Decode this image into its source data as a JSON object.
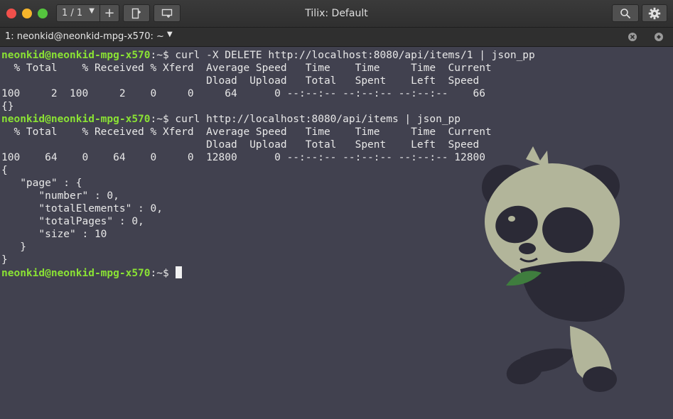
{
  "window": {
    "title": "Tilix: Default"
  },
  "header": {
    "session_counter": "1 / 1",
    "add_label": "+"
  },
  "tab": {
    "label": "1: neonkid@neonkid-mpg-x570: ~"
  },
  "colors": {
    "background": "#41414f",
    "prompt": "#8ae234",
    "text": "#e8e8e8"
  },
  "terminal": {
    "lines": [
      {
        "prompt": "neonkid@neonkid-mpg-x570",
        "text": ":~$ curl -X DELETE http://localhost:8080/api/items/1 | json_pp"
      },
      {
        "text": "  % Total    % Received % Xferd  Average Speed   Time    Time     Time  Current"
      },
      {
        "text": "                                 Dload  Upload   Total   Spent    Left  Speed"
      },
      {
        "text": "100     2  100     2    0     0     64      0 --:--:-- --:--:-- --:--:--    66"
      },
      {
        "text": "{}"
      },
      {
        "prompt": "neonkid@neonkid-mpg-x570",
        "text": ":~$ curl http://localhost:8080/api/items | json_pp"
      },
      {
        "text": "  % Total    % Received % Xferd  Average Speed   Time    Time     Time  Current"
      },
      {
        "text": "                                 Dload  Upload   Total   Spent    Left  Speed"
      },
      {
        "text": "100    64    0    64    0     0  12800      0 --:--:-- --:--:-- --:--:-- 12800"
      },
      {
        "text": "{"
      },
      {
        "text": "   \"page\" : {"
      },
      {
        "text": "      \"number\" : 0,"
      },
      {
        "text": "      \"totalElements\" : 0,"
      },
      {
        "text": "      \"totalPages\" : 0,"
      },
      {
        "text": "      \"size\" : 10"
      },
      {
        "text": "   }"
      },
      {
        "text": "}"
      },
      {
        "prompt": "neonkid@neonkid-mpg-x570",
        "text": ":~$ ",
        "cursor": true
      }
    ]
  },
  "icons": {
    "window_controls": [
      "close-icon",
      "minimize-icon",
      "maximize-icon"
    ],
    "toolbar": [
      "add-terminal-right-icon",
      "add-terminal-down-icon",
      "search-icon",
      "gear-icon"
    ],
    "tab": [
      "tab-close-icon",
      "tab-maximize-icon"
    ],
    "wallpaper": "panda-illustration"
  }
}
